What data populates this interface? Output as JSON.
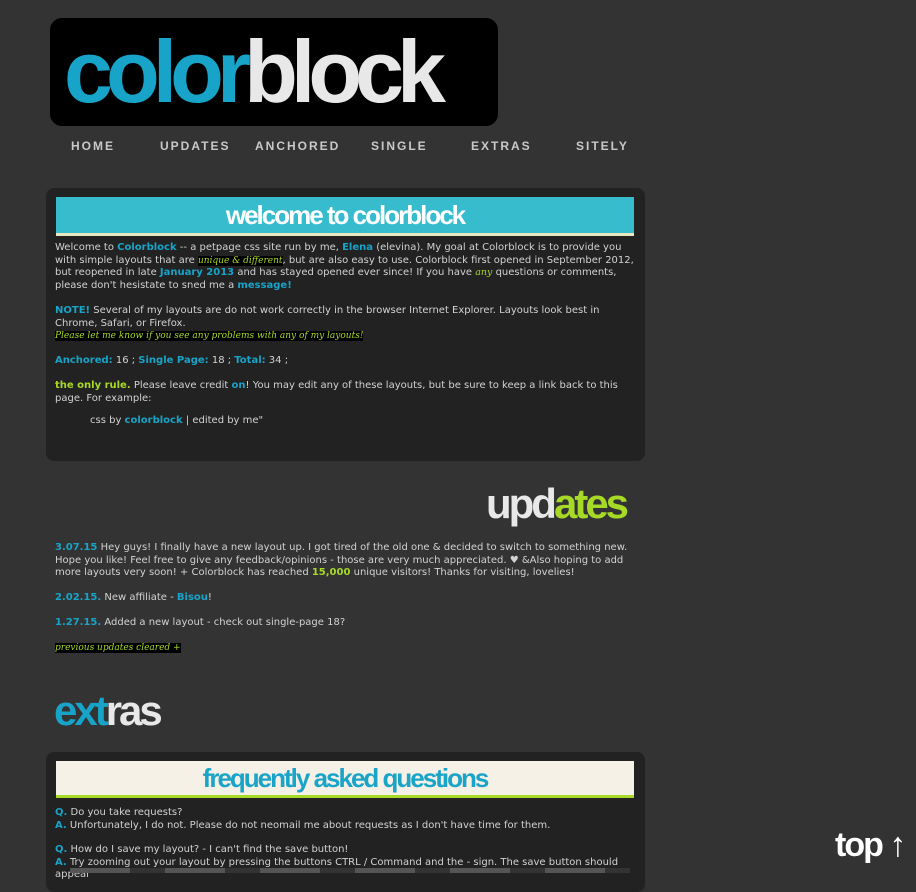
{
  "logo": {
    "part1": "color",
    "part2": "block"
  },
  "nav": [
    "HOME",
    "UPDATES",
    "ANCHORED",
    "SINGLE",
    "EXTRAS",
    "SITELY"
  ],
  "welcome": {
    "title": "welcome to colorblock",
    "p1": {
      "a": "Welcome to ",
      "b": "Colorblock",
      "c": " -- a petpage css site run by me, ",
      "d": "Elena",
      "e": " (elevina). My goal at Colorblock is to provide you with simple layouts that are ",
      "f": "unique & different",
      "g": ", but are also easy to use. Colorblock first opened in September 2012, but reopened in late ",
      "h": "January 2013",
      "i": " and has stayed opened ever since! If you have ",
      "j": "any",
      "k": " questions or comments, please don't hesistate to sned me a ",
      "l": "message!"
    },
    "note": {
      "label": "NOTE!",
      "text": " Several of my layouts are do not work correctly in the browser Internet Explorer. Layouts look best in Chrome, Safari, or Firefox.",
      "highlight": "Please let me know if you see any problems with any of my layouts!"
    },
    "counts": {
      "anchored_label": "Anchored:",
      "anchored": " 16 ; ",
      "single_label": "Single Page:",
      "single": " 18 ; ",
      "total_label": "Total:",
      "total": " 34 ;"
    },
    "rule": {
      "label": "the only rule.",
      "a": " Please leave credit ",
      "on": "on",
      "b": "! You may edit any of these layouts, but be sure to keep a link back to this page. For example:"
    },
    "credit": {
      "a": "css by ",
      "b": "colorblock",
      "c": " | edited by me\""
    }
  },
  "updates": {
    "heading1": "upd",
    "heading2": "ates",
    "entries": [
      {
        "date": "3.07.15",
        "a": " Hey guys! I finally have a new layout up. I got tired of the old one & decided to switch to something new. Hope you like! Feel free to give any feedback/opinions - those are very much appreciated. ♥ &Also hoping to add more layouts very soon! + Colorblock has reached ",
        "count": "15,000",
        "b": " unique visitors! Thanks for visiting, lovelies!"
      },
      {
        "date": "2.02.15.",
        "a": " New affiliate - ",
        "name": "Bisou",
        "b": "!"
      },
      {
        "date": "1.27.15.",
        "a": " Added a new layout - check out single-page 18?"
      }
    ],
    "cleared": "previous updates cleared +"
  },
  "extras": {
    "heading1": "ext",
    "heading2": "ras"
  },
  "faq": {
    "title": "frequently asked questions",
    "q_label": "Q.",
    "a_label": "A.",
    "items": [
      {
        "q": " Do you take requests?",
        "a": " Unfortunately, I do not. Please do not neomail me about requests as I don't have time for them."
      },
      {
        "q": " How do I save my layout? - I can't find the save button!",
        "a": " Try zooming out your layout by pressing the buttons CTRL / Command and the - sign. The save button should appear"
      }
    ]
  },
  "top_button": "top ↑",
  "colors": {
    "background": "#333333",
    "box": "#222222",
    "blue": "#17a4c8",
    "green": "#a7d927",
    "welcome_bar": "#36bccc",
    "faq_bar": "#f6f1e6"
  }
}
